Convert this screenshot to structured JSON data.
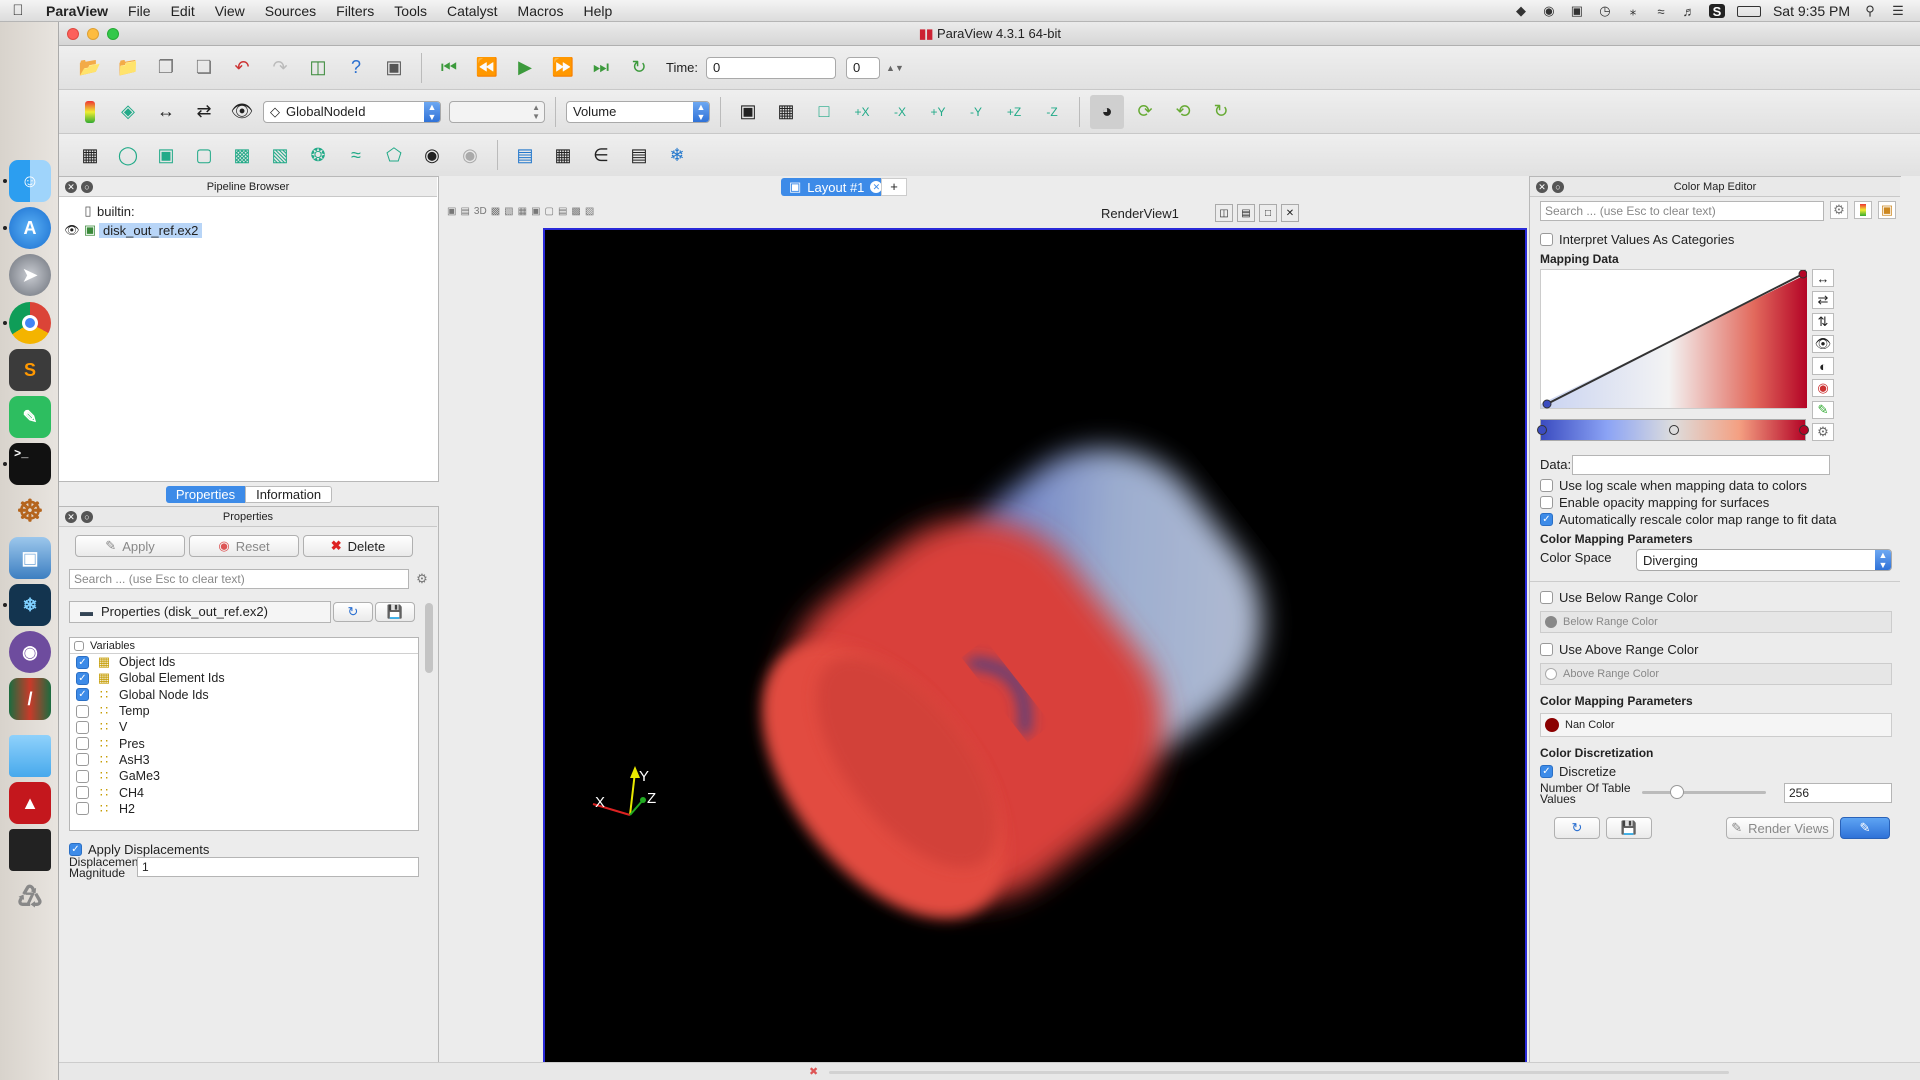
{
  "menubar": {
    "app": "ParaView",
    "items": [
      "File",
      "Edit",
      "View",
      "Sources",
      "Filters",
      "Tools",
      "Catalyst",
      "Macros",
      "Help"
    ],
    "clock": "Sat 9:35 PM"
  },
  "window": {
    "title": "ParaView 4.3.1 64-bit"
  },
  "toolbar1": {
    "time_label": "Time:",
    "time_value": "0",
    "timestep_value": "0"
  },
  "toolbar2": {
    "array_combo": "GlobalNodeId",
    "component_combo": "",
    "representation_combo": "Volume"
  },
  "pipeline": {
    "title": "Pipeline Browser",
    "items": [
      {
        "label": "builtin:"
      },
      {
        "label": "disk_out_ref.ex2",
        "selected": true
      }
    ]
  },
  "tabs": {
    "properties": "Properties",
    "information": "Information"
  },
  "properties": {
    "title": "Properties",
    "apply": "Apply",
    "reset": "Reset",
    "delete": "Delete",
    "help": "?",
    "search_placeholder": "Search ... (use Esc to clear text)",
    "group_title": "Properties (disk_out_ref.ex2)",
    "variables_header": "Variables",
    "variables": [
      {
        "name": "Object Ids",
        "checked": true
      },
      {
        "name": "Global Element Ids",
        "checked": true
      },
      {
        "name": "Global Node Ids",
        "checked": true
      },
      {
        "name": "Temp",
        "checked": false
      },
      {
        "name": "V",
        "checked": false
      },
      {
        "name": "Pres",
        "checked": false
      },
      {
        "name": "AsH3",
        "checked": false
      },
      {
        "name": "GaMe3",
        "checked": false
      },
      {
        "name": "CH4",
        "checked": false
      },
      {
        "name": "H2",
        "checked": false
      }
    ],
    "apply_displacements": "Apply Displacements",
    "displacement_label": "Displacement Magnitude",
    "displacement_value": "1"
  },
  "layout": {
    "tab_label": "Layout #1",
    "add_tab": "+",
    "view_name": "RenderView1",
    "view_toolbar_3d": "3D"
  },
  "axes": {
    "x": "X",
    "y": "Y",
    "z": "Z"
  },
  "colormap": {
    "title": "Color Map Editor",
    "search_placeholder": "Search ... (use Esc to clear text)",
    "interpret_categories": "Interpret Values As Categories",
    "mapping_data": "Mapping Data",
    "data_label": "Data:",
    "data_value": "",
    "log_scale": "Use log scale when mapping data to colors",
    "opacity_mapping": "Enable opacity mapping for surfaces",
    "auto_rescale": "Automatically rescale color map range to fit data",
    "params_title": "Color Mapping Parameters",
    "color_space_label": "Color Space",
    "color_space_value": "Diverging",
    "use_below": "Use Below Range Color",
    "below_color": "Below Range Color",
    "use_above": "Use Above Range Color",
    "above_color": "Above Range Color",
    "params_title2": "Color Mapping Parameters",
    "nan_color": "Nan Color",
    "discretization_title": "Color Discretization",
    "discretize": "Discretize",
    "table_values_label": "Number Of Table Values",
    "table_values": "256",
    "render_views": "Render Views",
    "colors": {
      "low": "#3b4cc0",
      "high": "#b40426",
      "nan": "#8b0000"
    }
  }
}
